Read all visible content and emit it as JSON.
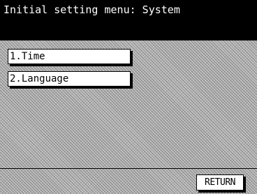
{
  "title_bar": {
    "title": "Initial setting menu: System"
  },
  "menu": {
    "items": [
      {
        "label": "1.Time"
      },
      {
        "label": "2.Language"
      }
    ]
  },
  "footer": {
    "return_label": "RETURN"
  },
  "colors": {
    "title_background": "#000000",
    "title_text": "#ffffff",
    "button_background": "#ffffff",
    "pattern_background": "#c4c4c4"
  }
}
